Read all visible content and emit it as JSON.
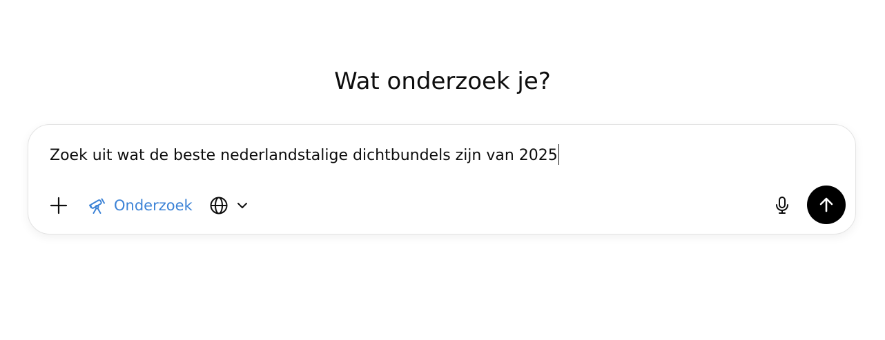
{
  "header": {
    "title": "Wat onderzoek je?"
  },
  "composer": {
    "prompt_text": "Zoek uit wat de beste nederlandstalige dichtbundels zijn van 2025",
    "tools": {
      "attach_icon": "plus-icon",
      "research": {
        "label": "Onderzoek",
        "icon": "telescope-icon",
        "active": true,
        "color": "#3b82d6"
      },
      "web_search": {
        "icon": "globe-icon",
        "dropdown_icon": "chevron-down-icon"
      },
      "voice_icon": "microphone-icon",
      "send_icon": "arrow-up-icon"
    }
  },
  "colors": {
    "text": "#0d0d0d",
    "accent": "#3b82d6",
    "send_button": "#000000",
    "border": "#e3e3e3"
  }
}
